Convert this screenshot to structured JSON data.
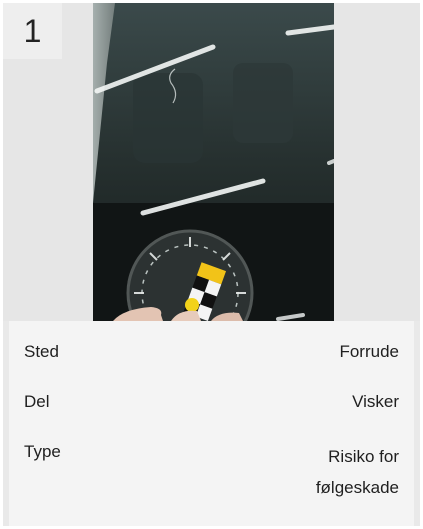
{
  "card": {
    "index": "1",
    "details": [
      {
        "label": "Sted",
        "value": "Forrude"
      },
      {
        "label": "Del",
        "value": "Visker"
      },
      {
        "label": "Type",
        "value": "Risiko for følgeskade"
      }
    ]
  }
}
